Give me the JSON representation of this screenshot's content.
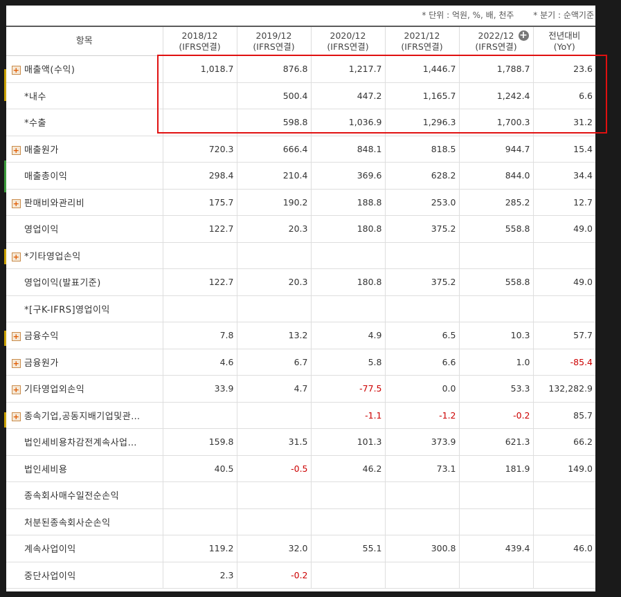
{
  "units_note": {
    "unit": "* 단위 : 억원, %, 배, 천주",
    "period": "* 분기 : 순액기준"
  },
  "header": {
    "item": "항목",
    "years": [
      {
        "year": "2018/12",
        "basis": "(IFRS연결)"
      },
      {
        "year": "2019/12",
        "basis": "(IFRS연결)"
      },
      {
        "year": "2020/12",
        "basis": "(IFRS연결)"
      },
      {
        "year": "2021/12",
        "basis": "(IFRS연결)"
      },
      {
        "year": "2022/12",
        "basis": "(IFRS연결)"
      }
    ],
    "yoy_title": "전년대비",
    "yoy_sub": "(YoY)",
    "expand_icon": "plus-circle-icon"
  },
  "rows": [
    {
      "label": "매출액(수익)",
      "expandable": true,
      "values": [
        "1,018.7",
        "876.8",
        "1,217.7",
        "1,446.7",
        "1,788.7",
        "23.6"
      ]
    },
    {
      "label": "*내수",
      "expandable": false,
      "values": [
        "",
        "500.4",
        "447.2",
        "1,165.7",
        "1,242.4",
        "6.6"
      ]
    },
    {
      "label": "*수출",
      "expandable": false,
      "values": [
        "",
        "598.8",
        "1,036.9",
        "1,296.3",
        "1,700.3",
        "31.2"
      ]
    },
    {
      "label": "매출원가",
      "expandable": true,
      "values": [
        "720.3",
        "666.4",
        "848.1",
        "818.5",
        "944.7",
        "15.4"
      ]
    },
    {
      "label": "매출총이익",
      "expandable": false,
      "values": [
        "298.4",
        "210.4",
        "369.6",
        "628.2",
        "844.0",
        "34.4"
      ]
    },
    {
      "label": "판매비와관리비",
      "expandable": true,
      "values": [
        "175.7",
        "190.2",
        "188.8",
        "253.0",
        "285.2",
        "12.7"
      ]
    },
    {
      "label": "영업이익",
      "expandable": false,
      "values": [
        "122.7",
        "20.3",
        "180.8",
        "375.2",
        "558.8",
        "49.0"
      ]
    },
    {
      "label": "*기타영업손익",
      "expandable": true,
      "values": [
        "",
        "",
        "",
        "",
        "",
        ""
      ]
    },
    {
      "label": "영업이익(발표기준)",
      "expandable": false,
      "values": [
        "122.7",
        "20.3",
        "180.8",
        "375.2",
        "558.8",
        "49.0"
      ]
    },
    {
      "label": "*[구K-IFRS]영업이익",
      "expandable": false,
      "values": [
        "",
        "",
        "",
        "",
        "",
        ""
      ]
    },
    {
      "label": "금융수익",
      "expandable": true,
      "values": [
        "7.8",
        "13.2",
        "4.9",
        "6.5",
        "10.3",
        "57.7"
      ]
    },
    {
      "label": "금융원가",
      "expandable": true,
      "values": [
        "4.6",
        "6.7",
        "5.8",
        "6.6",
        "1.0",
        "-85.4"
      ]
    },
    {
      "label": "기타영업외손익",
      "expandable": true,
      "values": [
        "33.9",
        "4.7",
        "-77.5",
        "0.0",
        "53.3",
        "132,282.9"
      ]
    },
    {
      "label": "종속기업,공동지배기업및관…",
      "expandable": true,
      "values": [
        "",
        "",
        "-1.1",
        "-1.2",
        "-0.2",
        "85.7"
      ]
    },
    {
      "label": "법인세비용차감전계속사업…",
      "expandable": false,
      "values": [
        "159.8",
        "31.5",
        "101.3",
        "373.9",
        "621.3",
        "66.2"
      ]
    },
    {
      "label": "법인세비용",
      "expandable": false,
      "values": [
        "40.5",
        "-0.5",
        "46.2",
        "73.1",
        "181.9",
        "149.0"
      ]
    },
    {
      "label": "종속회사매수일전순손익",
      "expandable": false,
      "values": [
        "",
        "",
        "",
        "",
        "",
        ""
      ]
    },
    {
      "label": "처분된종속회사순손익",
      "expandable": false,
      "values": [
        "",
        "",
        "",
        "",
        "",
        ""
      ]
    },
    {
      "label": "계속사업이익",
      "expandable": false,
      "values": [
        "119.2",
        "32.0",
        "55.1",
        "300.8",
        "439.4",
        "46.0"
      ]
    },
    {
      "label": "중단사업이익",
      "expandable": false,
      "values": [
        "2.3",
        "-0.2",
        "",
        "",
        "",
        ""
      ]
    }
  ],
  "colors": {
    "negative": "#cc0000",
    "highlight_border": "#e01010",
    "expand_icon": "#e05a00"
  }
}
